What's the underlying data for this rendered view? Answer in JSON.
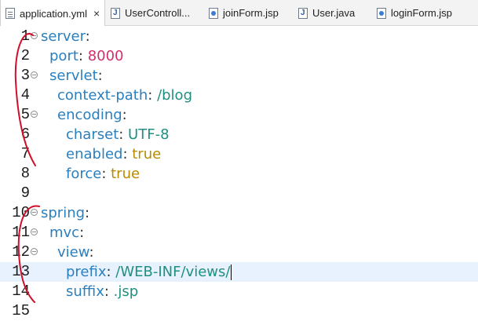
{
  "tabs": [
    {
      "label": "application.yml",
      "icon": "yml-file-icon",
      "active": true
    },
    {
      "label": "UserControll...",
      "icon": "java-file-icon",
      "active": false
    },
    {
      "label": "joinForm.jsp",
      "icon": "jsp-file-icon",
      "active": false
    },
    {
      "label": "User.java",
      "icon": "java-file-icon",
      "active": false
    },
    {
      "label": "loginForm.jsp",
      "icon": "jsp-file-icon",
      "active": false
    }
  ],
  "close_glyph": "×",
  "editor": {
    "current_line": 13,
    "lines": [
      {
        "n": "1",
        "fold": true,
        "key": "server",
        "sep": ":",
        "value": "",
        "vtype": ""
      },
      {
        "n": "2",
        "fold": false,
        "key": "port",
        "sep": ": ",
        "value": "8000",
        "vtype": "num"
      },
      {
        "n": "3",
        "fold": true,
        "key": "servlet",
        "sep": ":",
        "value": "",
        "vtype": ""
      },
      {
        "n": "4",
        "fold": false,
        "key": "context-path",
        "sep": ": ",
        "value": "/blog",
        "vtype": "str"
      },
      {
        "n": "5",
        "fold": true,
        "key": "encoding",
        "sep": ":",
        "value": "",
        "vtype": ""
      },
      {
        "n": "6",
        "fold": false,
        "key": "charset",
        "sep": ": ",
        "value": "UTF-8",
        "vtype": "str"
      },
      {
        "n": "7",
        "fold": false,
        "key": "enabled",
        "sep": ": ",
        "value": "true",
        "vtype": "bool"
      },
      {
        "n": "8",
        "fold": false,
        "key": "force",
        "sep": ": ",
        "value": "true",
        "vtype": "bool"
      },
      {
        "n": "9",
        "fold": false,
        "key": "",
        "sep": "",
        "value": "",
        "vtype": ""
      },
      {
        "n": "10",
        "fold": true,
        "key": "spring",
        "sep": ":",
        "value": "",
        "vtype": ""
      },
      {
        "n": "11",
        "fold": true,
        "key": "mvc",
        "sep": ":",
        "value": "",
        "vtype": ""
      },
      {
        "n": "12",
        "fold": true,
        "key": "view",
        "sep": ":",
        "value": "",
        "vtype": ""
      },
      {
        "n": "13",
        "fold": false,
        "key": "prefix",
        "sep": ": ",
        "value": "/WEB-INF/views/",
        "vtype": "str"
      },
      {
        "n": "14",
        "fold": false,
        "key": "suffix",
        "sep": ": ",
        "value": ".jsp",
        "vtype": "str"
      },
      {
        "n": "15",
        "fold": false,
        "key": "",
        "sep": "",
        "value": "",
        "vtype": ""
      }
    ]
  },
  "colors": {
    "key": "#2a7fbf",
    "number": "#d0306d",
    "string": "#1f8f80",
    "boolean": "#b88a00",
    "annotation": "#d0102a",
    "current_line_bg": "#e8f2fe"
  }
}
